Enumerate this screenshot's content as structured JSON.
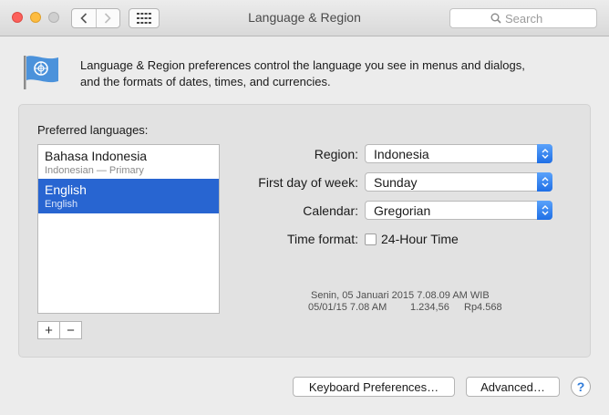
{
  "window": {
    "title": "Language & Region"
  },
  "toolbar": {
    "search_placeholder": "Search"
  },
  "header": {
    "description_line1": "Language & Region preferences control the language you see in menus and dialogs,",
    "description_line2": "and the formats of dates, times, and currencies."
  },
  "preferred_languages": {
    "label": "Preferred languages:",
    "items": [
      {
        "name": "Bahasa Indonesia",
        "subtitle": "Indonesian — Primary",
        "selected": false
      },
      {
        "name": "English",
        "subtitle": "English",
        "selected": true
      }
    ],
    "add_label": "+",
    "remove_label": "−"
  },
  "settings": {
    "region_label": "Region:",
    "region_value": "Indonesia",
    "first_day_label": "First day of week:",
    "first_day_value": "Sunday",
    "calendar_label": "Calendar:",
    "calendar_value": "Gregorian",
    "time_format_label": "Time format:",
    "time_format_option": "24-Hour Time",
    "time_format_checked": false
  },
  "example": {
    "date_line": "Senin, 05 Januari 2015 7.08.09 AM WIB",
    "short_date": "05/01/15 7.08 AM",
    "number": "1.234,56",
    "currency": "Rp4.568"
  },
  "buttons": {
    "keyboard_prefs": "Keyboard Preferences…",
    "advanced": "Advanced…",
    "help": "?"
  },
  "colors": {
    "selection": "#2865d1",
    "close_light": "#fc605b",
    "minimize_light": "#fdbc40",
    "popup_arrow": "#3b87f0",
    "flag_blue": "#4b92db"
  },
  "icons": [
    "back-arrow-icon",
    "forward-arrow-icon",
    "show-all-grid-icon",
    "search-icon",
    "un-flag-icon",
    "popup-arrows-icon",
    "help-icon"
  ]
}
